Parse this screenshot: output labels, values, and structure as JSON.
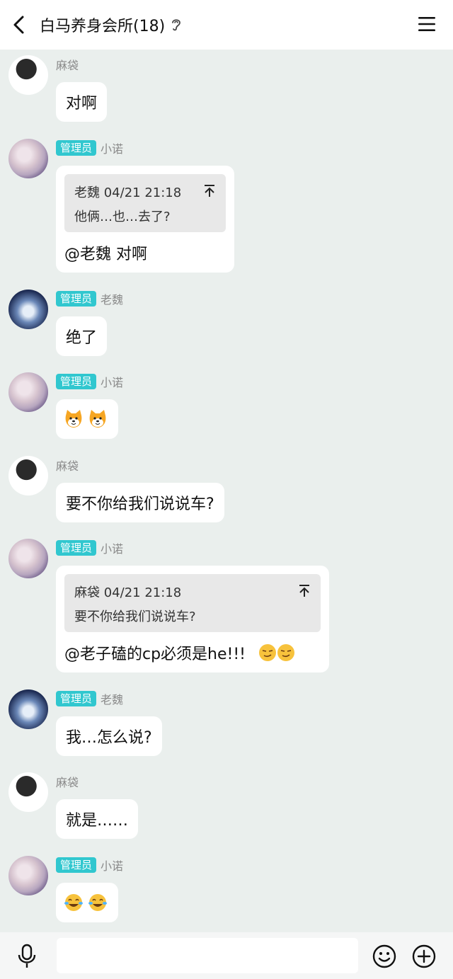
{
  "header": {
    "title": "白马养身会所(18)"
  },
  "badge_label": "管理员",
  "messages": [
    {
      "sender": "麻袋",
      "text": "对啊"
    },
    {
      "sender": "小诺",
      "quote_head": "老魏 04/21 21:18",
      "quote_body": "他俩…也…去了?",
      "text": "@老魏 对啊"
    },
    {
      "sender": "老魏",
      "text": "绝了"
    },
    {
      "sender": "小诺",
      "emoji": "dog-face-emoji"
    },
    {
      "sender": "麻袋",
      "text": "要不你给我们说说车?"
    },
    {
      "sender": "小诺",
      "quote_head": "麻袋 04/21 21:18",
      "quote_body": "要不你给我们说说车?",
      "text": "@老子磕的cp必须是he!!!",
      "emoji": "smirk-emoji"
    },
    {
      "sender": "老魏",
      "text": "我…怎么说?"
    },
    {
      "sender": "麻袋",
      "text": "就是……"
    },
    {
      "sender": "小诺",
      "emoji": "laughing-tears-emoji"
    }
  ],
  "input": {
    "placeholder": ""
  },
  "icons": {
    "back": "back-arrow-icon",
    "ear": "ear-icon",
    "menu": "hamburger-menu-icon",
    "mic": "microphone-icon",
    "emoji": "smiley-icon",
    "plus": "plus-icon"
  },
  "colors": {
    "badge": "#31c7cf",
    "background": "#eaefed",
    "bubble": "#ffffff"
  }
}
